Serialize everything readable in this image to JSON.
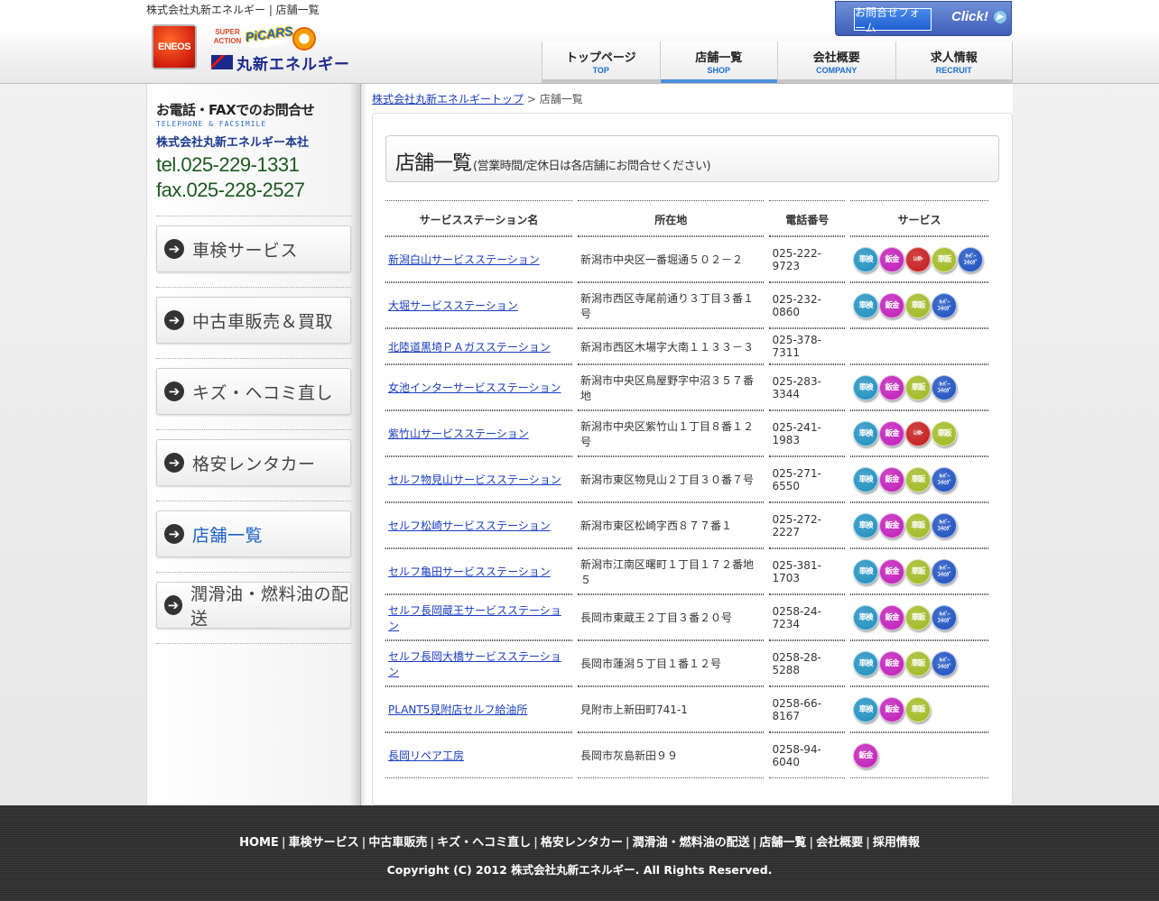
{
  "header": {
    "site_title": "株式会社丸新エネルギー | 店舗一覧",
    "logos": {
      "eneos": "ENEOS",
      "superaction": "SUPER ACTION",
      "picars": "PiCARS",
      "company": "丸新エネルギー"
    },
    "contact": {
      "form_label": "お問合せフォーム",
      "click_label": "Click!"
    },
    "nav": [
      {
        "jp": "トップページ",
        "en": "TOP"
      },
      {
        "jp": "店舗一覧",
        "en": "SHOP",
        "active": true
      },
      {
        "jp": "会社概要",
        "en": "COMPANY"
      },
      {
        "jp": "求人情報",
        "en": "RECRUIT"
      }
    ]
  },
  "sidebar": {
    "tel_title": "お電話・FAXでのお問合せ",
    "tel_sub": "TELEPHONE & FACSIMILE",
    "company": "株式会社丸新エネルギー本社",
    "tel": "tel.025-229-1331",
    "fax": "fax.025-228-2527",
    "items": [
      {
        "label": "車検サービス"
      },
      {
        "label": "中古車販売＆買取"
      },
      {
        "label": "キズ・ヘコミ直し"
      },
      {
        "label": "格安レンタカー"
      },
      {
        "label": "店舗一覧",
        "current": true
      },
      {
        "label": "潤滑油・燃料油の配送"
      }
    ]
  },
  "breadcrumb": {
    "home": "株式会社丸新エネルギートップ",
    "sep": ">",
    "current": "店舗一覧"
  },
  "main": {
    "title": "店舗一覧",
    "note": "(営業時間/定休日は各店舗にお問合せください)",
    "columns": [
      "サービスステーション名",
      "所在地",
      "電話番号",
      "サービス"
    ],
    "service_types": {
      "shaken": {
        "label": "車検",
        "color": "#1e8fbf"
      },
      "bankin": {
        "label": "鈑金",
        "color": "#c01cb8"
      },
      "rental": {
        "label": "レンタカー",
        "color": "#c41818"
      },
      "hanbai": {
        "label": "車販",
        "color": "#a0b820"
      },
      "coating": {
        "label": "キーパーコーティング",
        "color": "#1b4fbf"
      }
    },
    "rows": [
      {
        "name": "新潟白山サービスステーション",
        "address": "新潟市中央区一番堀通５０２－２",
        "tel": "025-222-9723",
        "services": [
          "shaken",
          "bankin",
          "rental",
          "hanbai",
          "coating"
        ]
      },
      {
        "name": "大堀サービスステーション",
        "address": "新潟市西区寺尾前通り３丁目３番１号",
        "tel": "025-232-0860",
        "services": [
          "shaken",
          "bankin",
          "hanbai",
          "coating"
        ]
      },
      {
        "name": "北陸道黒埼ＰＡガスステーション",
        "address": "新潟市西区木場字大南１１３３－３",
        "tel": "025-378-7311",
        "services": []
      },
      {
        "name": "女池インターサービスステーション",
        "address": "新潟市中央区鳥屋野字中沼３５７番地",
        "tel": "025-283-3344",
        "services": [
          "shaken",
          "bankin",
          "hanbai",
          "coating"
        ]
      },
      {
        "name": "紫竹山サービスステーション",
        "address": "新潟市中央区紫竹山１丁目８番１２号",
        "tel": "025-241-1983",
        "services": [
          "shaken",
          "bankin",
          "rental",
          "hanbai"
        ]
      },
      {
        "name": "セルフ物見山サービスステーション",
        "address": "新潟市東区物見山２丁目３０番７号",
        "tel": "025-271-6550",
        "services": [
          "shaken",
          "bankin",
          "hanbai",
          "coating"
        ]
      },
      {
        "name": "セルフ松崎サービスステーション",
        "address": "新潟市東区松崎字西８７７番１",
        "tel": "025-272-2227",
        "services": [
          "shaken",
          "bankin",
          "hanbai",
          "coating"
        ]
      },
      {
        "name": "セルフ亀田サービスステーション",
        "address": "新潟市江南区曙町１丁目１７２番地５",
        "tel": "025-381-1703",
        "services": [
          "shaken",
          "bankin",
          "hanbai",
          "coating"
        ]
      },
      {
        "name": "セルフ長岡蔵王サービスステーション",
        "address": "長岡市東蔵王２丁目３番２０号",
        "tel": "0258-24-7234",
        "services": [
          "shaken",
          "bankin",
          "hanbai",
          "coating"
        ]
      },
      {
        "name": "セルフ長岡大橋サービスステーション",
        "address": "長岡市蓮潟５丁目１番１２号",
        "tel": "0258-28-5288",
        "services": [
          "shaken",
          "bankin",
          "hanbai",
          "coating"
        ]
      },
      {
        "name": "PLANT5見附店セルフ給油所",
        "address": "見附市上新田町741-1",
        "tel": "0258-66-8167",
        "services": [
          "shaken",
          "bankin",
          "hanbai"
        ]
      },
      {
        "name": "長岡リペア工房",
        "address": "長岡市灰島新田９９",
        "tel": "0258-94-6040",
        "services": [
          "bankin"
        ]
      }
    ]
  },
  "footer": {
    "nav": [
      "HOME",
      "車検サービス",
      "中古車販売",
      "キズ・ヘコミ直し",
      "格安レンタカー",
      "潤滑油・燃料油の配送",
      "店舗一覧",
      "会社概要",
      "採用情報"
    ],
    "separator": "|",
    "copyright": "Copyright (C) 2012 株式会社丸新エネルギー. All Rights Reserved."
  }
}
